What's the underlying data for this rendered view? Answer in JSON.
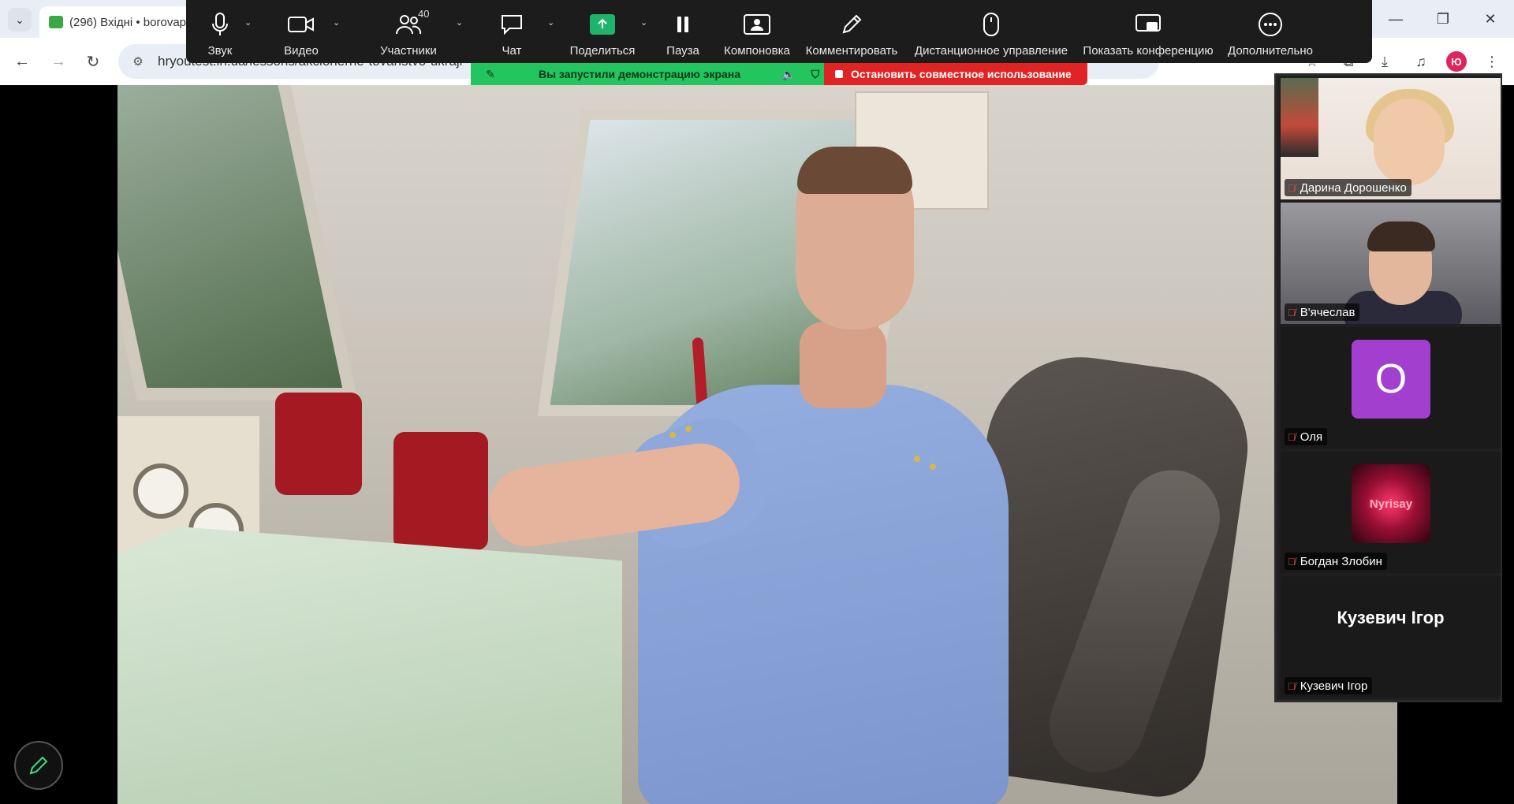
{
  "browser": {
    "tab_title": "(296) Вхідні • borovap",
    "address": "hryoutest.in.ua/lessons/akcionerne-tovaristvo-ukraji",
    "profile_initial": "Ю"
  },
  "toolbar": {
    "audio_label": "Звук",
    "video_label": "Видео",
    "participants_label": "Участники",
    "participants_count": "40",
    "chat_label": "Чат",
    "share_label": "Поделиться",
    "pause_label": "Пауза",
    "layout_label": "Компоновка",
    "annotate_label": "Комментировать",
    "remote_label": "Дистанционное управление",
    "show_meeting_label": "Показать конференцию",
    "more_label": "Дополнительно"
  },
  "share_banner": {
    "status": "Вы запустили демонстрацию экрана",
    "stop": "Остановить совместное использование",
    "status_color": "#22c55e",
    "stop_color": "#e02424"
  },
  "participants": [
    {
      "name": "Дарина Дорошенко",
      "muted": true,
      "type": "video"
    },
    {
      "name": "В'ячеслав",
      "muted": true,
      "type": "video"
    },
    {
      "name": "Оля",
      "muted": true,
      "type": "avatar",
      "initial": "О",
      "avatar_color": "#a33fcf"
    },
    {
      "name": "Богдан Злобин",
      "muted": true,
      "type": "image",
      "image_text": "Nyrisay"
    },
    {
      "name": "Кузевич Ігор",
      "muted": true,
      "type": "name-only"
    }
  ]
}
